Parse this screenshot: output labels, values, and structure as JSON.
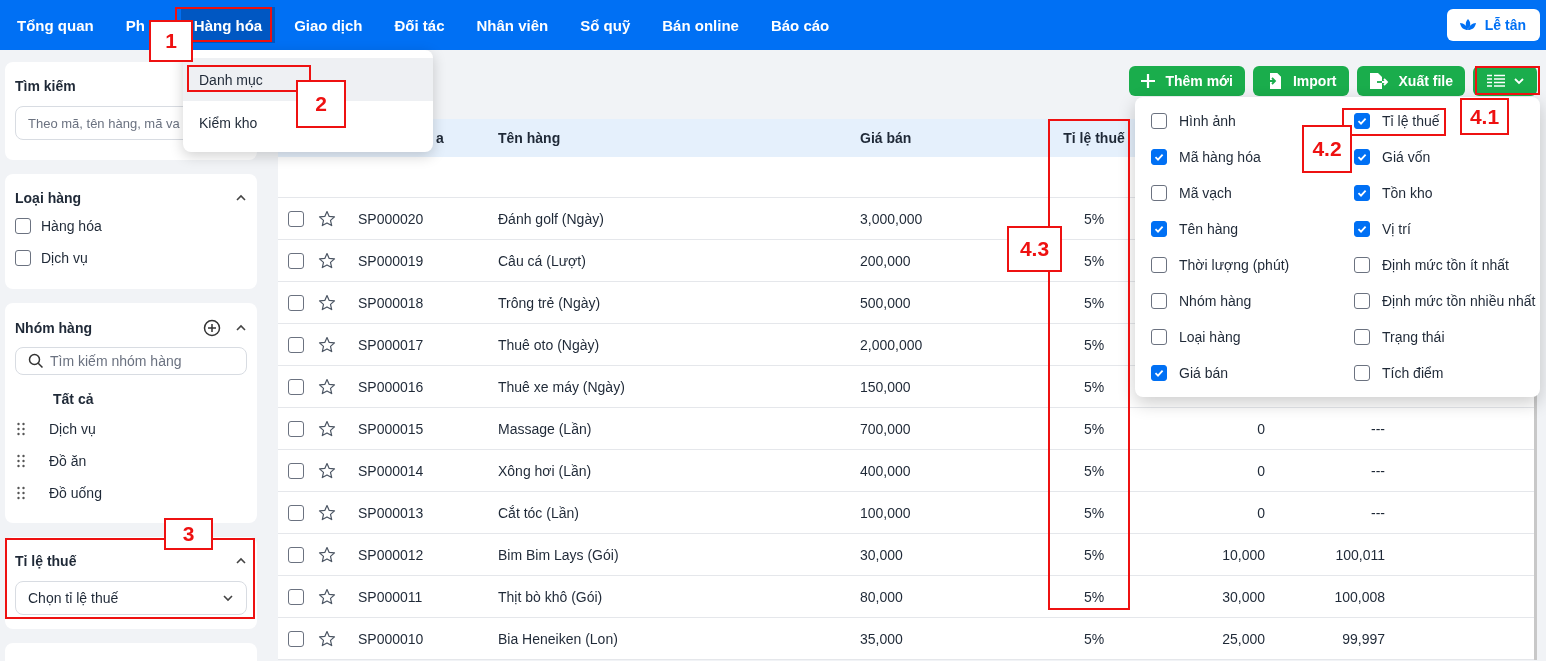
{
  "nav": {
    "items": [
      {
        "label": "Tổng quan",
        "selected": false
      },
      {
        "label": "Ph",
        "selected": false
      },
      {
        "label": "Hàng hóa",
        "selected": true
      },
      {
        "label": "Giao dịch",
        "selected": false
      },
      {
        "label": "Đối tác",
        "selected": false
      },
      {
        "label": "Nhân viên",
        "selected": false
      },
      {
        "label": "Sổ quỹ",
        "selected": false
      },
      {
        "label": "Bán online",
        "selected": false
      },
      {
        "label": "Báo cáo",
        "selected": false
      }
    ],
    "right_button": "Lễ tân"
  },
  "nav_dropdown": {
    "items": [
      {
        "label": "Danh mục",
        "selected": true
      },
      {
        "label": "Kiểm kho",
        "selected": false
      }
    ]
  },
  "sidebar": {
    "search": {
      "title": "Tìm kiếm",
      "placeholder": "Theo mã, tên hàng, mã va"
    },
    "product_type": {
      "title": "Loại hàng",
      "options": [
        {
          "label": "Hàng hóa",
          "checked": false
        },
        {
          "label": "Dịch vụ",
          "checked": false
        }
      ]
    },
    "product_group": {
      "title": "Nhóm hàng",
      "search_placeholder": "Tìm kiếm nhóm hàng",
      "all_label": "Tất cả",
      "items": [
        "Dịch vụ",
        "Đồ ăn",
        "Đồ uống"
      ]
    },
    "tax_rate": {
      "title": "Tỉ lệ thuế",
      "select_placeholder": "Chọn tỉ lệ thuế"
    }
  },
  "toolbar": {
    "buttons": [
      "Thêm mới",
      "Import",
      "Xuất file"
    ]
  },
  "column_picker": {
    "options": [
      {
        "label": "Hình ảnh",
        "checked": false
      },
      {
        "label": "Mã hàng hóa",
        "checked": true
      },
      {
        "label": "Mã vạch",
        "checked": false
      },
      {
        "label": "Tên hàng",
        "checked": true
      },
      {
        "label": "Thời lượng (phút)",
        "checked": false
      },
      {
        "label": "Nhóm hàng",
        "checked": false
      },
      {
        "label": "Loại hàng",
        "checked": false
      },
      {
        "label": "Giá bán",
        "checked": true
      },
      {
        "label": "Tỉ lệ thuế",
        "checked": true
      },
      {
        "label": "Giá vốn",
        "checked": true
      },
      {
        "label": "Tồn kho",
        "checked": true
      },
      {
        "label": "Vị trí",
        "checked": true
      },
      {
        "label": "Định mức tồn ít nhất",
        "checked": false
      },
      {
        "label": "Định mức tồn nhiều nhất",
        "checked": false
      },
      {
        "label": "Trạng thái",
        "checked": false
      },
      {
        "label": "Tích điểm",
        "checked": false
      }
    ]
  },
  "table": {
    "columns": [
      "a",
      "Tên hàng",
      "Giá bán",
      "Tỉ lệ thuế"
    ],
    "rows": [
      {
        "checked": false,
        "code": "SP000020",
        "name": "Đánh golf (Ngày)",
        "price": "3,000,000",
        "tax": "5%"
      },
      {
        "checked": false,
        "code": "SP000019",
        "name": "Câu cá (Lượt)",
        "price": "200,000",
        "tax": "5%"
      },
      {
        "checked": false,
        "code": "SP000018",
        "name": "Trông trẻ (Ngày)",
        "price": "500,000",
        "tax": "5%"
      },
      {
        "checked": false,
        "code": "SP000017",
        "name": "Thuê oto (Ngày)",
        "price": "2,000,000",
        "tax": "5%"
      },
      {
        "checked": false,
        "code": "SP000016",
        "name": "Thuê xe máy (Ngày)",
        "price": "150,000",
        "tax": "5%"
      },
      {
        "checked": false,
        "code": "SP000015",
        "name": "Massage (Lần)",
        "price": "700,000",
        "tax": "5%",
        "column_7": "0",
        "column_8": "---"
      },
      {
        "checked": false,
        "code": "SP000014",
        "name": "Xông hơi (Lần)",
        "price": "400,000",
        "tax": "5%",
        "column_7": "0",
        "column_8": "---"
      },
      {
        "checked": false,
        "code": "SP000013",
        "name": "Cắt tóc (Lần)",
        "price": "100,000",
        "tax": "5%",
        "column_7": "0",
        "column_8": "---"
      },
      {
        "checked": false,
        "code": "SP000012",
        "name": "Bim Bim Lays (Gói)",
        "price": "30,000",
        "tax": "5%",
        "column_7": "10,000",
        "column_8": "100,011"
      },
      {
        "checked": false,
        "code": "SP000011",
        "name": "Thịt bò khô (Gói)",
        "price": "80,000",
        "tax": "5%",
        "column_7": "30,000",
        "column_8": "100,008"
      },
      {
        "checked": false,
        "code": "SP000010",
        "name": "Bia Heneiken (Lon)",
        "price": "35,000",
        "tax": "5%",
        "column_7": "25,000",
        "column_8": "99,997"
      }
    ]
  },
  "annotations": [
    {
      "label": "1"
    },
    {
      "label": "2"
    },
    {
      "label": "3"
    },
    {
      "label": "4.1"
    },
    {
      "label": "4.2"
    },
    {
      "label": "4.3"
    }
  ]
}
